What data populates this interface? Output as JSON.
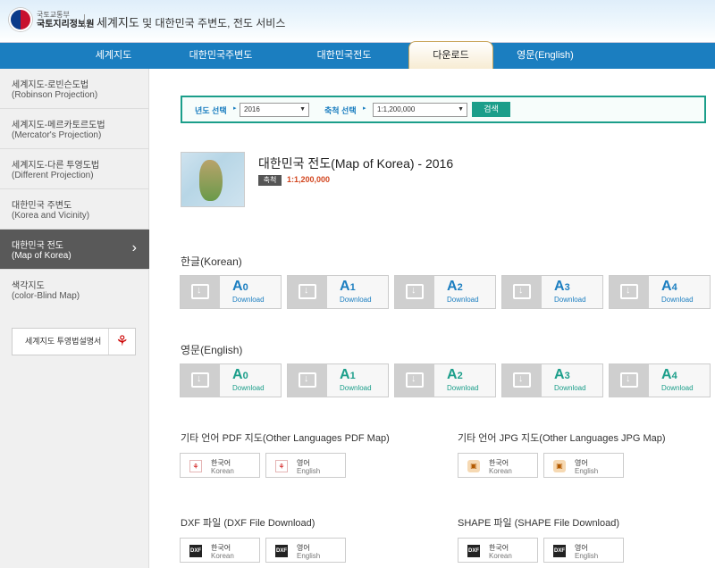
{
  "header": {
    "org_small": "국토교통부",
    "org_name": "국토지리정보원",
    "site_title": "세계지도",
    "site_subtitle": " 및 대한민국 주변도, 전도 서비스"
  },
  "nav": {
    "items": [
      "세계지도",
      "대한민국주변도",
      "대한민국전도",
      "다운로드",
      "영문(English)"
    ],
    "active": "다운로드"
  },
  "sidebar": {
    "items": [
      {
        "label": "세계지도-로빈슨도법",
        "en": "(Robinson Projection)"
      },
      {
        "label": "세계지도-메르카토르도법",
        "en": "(Mercator's Projection)"
      },
      {
        "label": "세계지도-다른 투영도법",
        "en": "(Different Projection)"
      },
      {
        "label": "대한민국 주변도",
        "en": "(Korea and Vicinity)"
      },
      {
        "label": "대한민국 전도",
        "en": "(Map of Korea)"
      },
      {
        "label": "색각지도",
        "en": "(color-Blind Map)"
      }
    ],
    "pdf_button": "세계지도 투영법설명서"
  },
  "search": {
    "year_label": "년도 선택",
    "year_value": "2016",
    "scale_label": "축척 선택",
    "scale_value": "1:1,200,000",
    "button": "검색"
  },
  "map": {
    "title": "대한민국 전도(Map of Korea) - 2016",
    "scale_badge": "축척",
    "scale_value": "1:1,200,000"
  },
  "korean_section": {
    "title": "한글(Korean)",
    "sizes": [
      "A0",
      "A1",
      "A2",
      "A3",
      "A4"
    ],
    "download_label": "Download"
  },
  "english_section": {
    "title": "영문(English)",
    "sizes": [
      "A0",
      "A1",
      "A2",
      "A3",
      "A4"
    ],
    "download_label": "Download"
  },
  "other_pdf": {
    "title": "기타 언어 PDF 지도(Other Languages PDF Map)",
    "buttons": [
      {
        "ko": "한국어",
        "en": "Korean"
      },
      {
        "ko": "영어",
        "en": "English"
      }
    ]
  },
  "other_jpg": {
    "title": "기타 언어 JPG 지도(Other Languages JPG Map)",
    "buttons": [
      {
        "ko": "한국어",
        "en": "Korean"
      },
      {
        "ko": "영어",
        "en": "English"
      }
    ]
  },
  "dxf": {
    "title": "DXF 파일 (DXF File Download)",
    "buttons": [
      {
        "ko": "한국어",
        "en": "Korean"
      },
      {
        "ko": "영어",
        "en": "English"
      }
    ]
  },
  "shape": {
    "title": "SHAPE 파일 (SHAPE File Download)",
    "buttons": [
      {
        "ko": "한국어",
        "en": "Korean"
      },
      {
        "ko": "영어",
        "en": "English"
      }
    ]
  },
  "icons": {
    "pdf": "pdf-icon",
    "jpg": "jpg-icon",
    "dxf": "dxf-icon",
    "download": "download-folder-icon"
  },
  "colors": {
    "nav_blue": "#1b7ec0",
    "teal": "#1b9e8a",
    "scale_orange": "#d2451e",
    "sidebar_active": "#595959"
  }
}
